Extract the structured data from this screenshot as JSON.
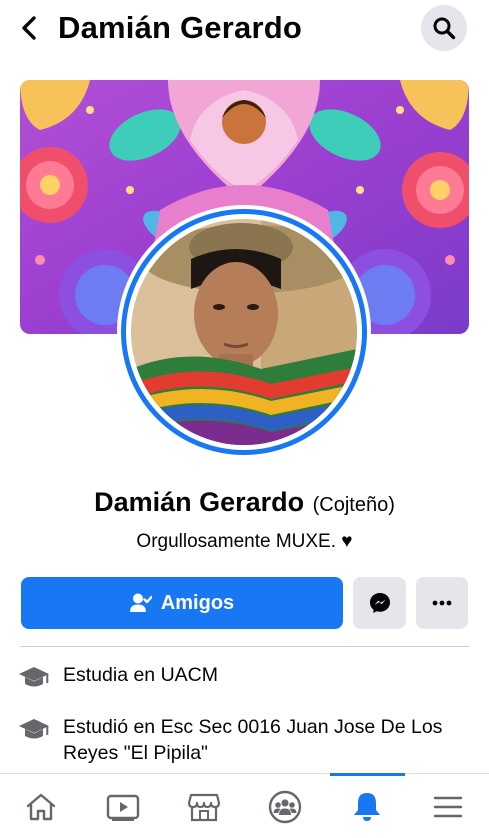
{
  "header": {
    "title": "Damián Gerardo"
  },
  "profile": {
    "name": "Damián Gerardo",
    "alternate_name": "(Cojteño)",
    "bio": "Orgullosamente MUXE. ♥"
  },
  "actions": {
    "friends_label": "Amigos"
  },
  "details": [
    {
      "prefix": "Estudia en ",
      "place": "UACM"
    },
    {
      "prefix": "Estudió en ",
      "place": "Esc Sec  0016 Juan Jose De Los Reyes \"El Pipila\""
    }
  ],
  "bottom_nav": [
    {
      "icon": "home-icon"
    },
    {
      "icon": "video-icon"
    },
    {
      "icon": "marketplace-icon"
    },
    {
      "icon": "groups-icon"
    },
    {
      "icon": "notifications-icon",
      "active": true
    },
    {
      "icon": "menu-icon"
    }
  ],
  "colors": {
    "accent": "#1877f2",
    "button_gray": "#e4e6eb",
    "text": "#050505",
    "icon_gray": "#65676b"
  }
}
